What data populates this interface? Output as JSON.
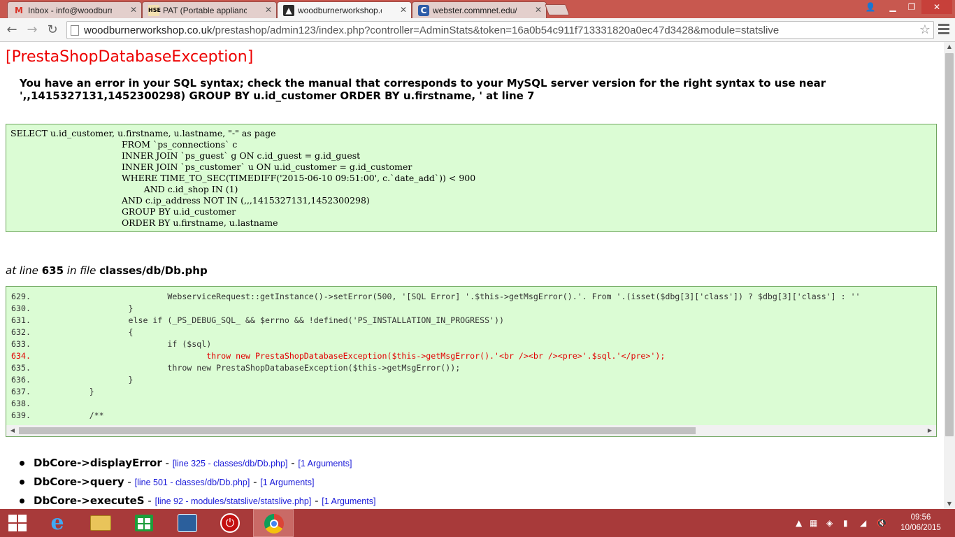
{
  "browser": {
    "tabs": [
      {
        "favicon": "gmail-icon",
        "label": "Inbox - info@woodburne",
        "active": false
      },
      {
        "favicon": "hse-icon",
        "label": "PAT (Portable appliance te",
        "active": false
      },
      {
        "favicon": "prestashop-icon",
        "label": "woodburnerworkshop.co.u",
        "active": true
      },
      {
        "favicon": "commnet-icon",
        "label": "webster.commnet.edu/dl/",
        "active": false
      }
    ],
    "url_host": "woodburnerworkshop.co.uk",
    "url_path": "/prestashop/admin123/index.php?controller=AdminStats&token=16a0b54c911f713331820a0ec47d3428&module=statslive"
  },
  "page": {
    "exception_title": "[PrestaShopDatabaseException]",
    "error_message": "You have an error in your SQL syntax; check the manual that corresponds to your MySQL server version for the right syntax to use near ',,1415327131,1452300298) GROUP BY u.id_customer ORDER BY u.firstname, ' at line 7",
    "sql_query": "SELECT u.id_customer, u.firstname, u.lastname, \"-\" as page\n\t\t\t\t\tFROM `ps_connections` c\n\t\t\t\t\tINNER JOIN `ps_guest` g ON c.id_guest = g.id_guest\n\t\t\t\t\tINNER JOIN `ps_customer` u ON u.id_customer = g.id_customer\n\t\t\t\t\tWHERE TIME_TO_SEC(TIMEDIFF('2015-06-10 09:51:00', c.`date_add`)) < 900\n\t\t\t\t\t\tAND c.id_shop IN (1)\n\t\t\t\t\tAND c.ip_address NOT IN (,,,1415327131,1452300298)\n\t\t\t\t\tGROUP BY u.id_customer\n\t\t\t\t\tORDER BY u.firstname, u.lastname",
    "at_line_prefix": "at line",
    "line_number": "635",
    "in_file_text": "in file",
    "file_path": "classes/db/Db.php",
    "code_lines": [
      {
        "no": "629.",
        "code": "\t\t\tWebserviceRequest::getInstance()->setError(500, '[SQL Error] '.$this->getMsgError().'. From '.(isset($dbg[3]['class']) ? $dbg[3]['class'] : ''",
        "error": false
      },
      {
        "no": "630.",
        "code": "\t\t}",
        "error": false
      },
      {
        "no": "631.",
        "code": "\t\telse if (_PS_DEBUG_SQL_ && $errno && !defined('PS_INSTALLATION_IN_PROGRESS'))",
        "error": false
      },
      {
        "no": "632.",
        "code": "\t\t{",
        "error": false
      },
      {
        "no": "633.",
        "code": "\t\t\tif ($sql)",
        "error": false
      },
      {
        "no": "634.",
        "code": "\t\t\t\tthrow new PrestaShopDatabaseException($this->getMsgError().'<br /><br /><pre>'.$sql.'</pre>');",
        "error": true
      },
      {
        "no": "635.",
        "code": "\t\t\tthrow new PrestaShopDatabaseException($this->getMsgError());",
        "error": false
      },
      {
        "no": "636.",
        "code": "\t\t}",
        "error": false
      },
      {
        "no": "637.",
        "code": "\t}",
        "error": false
      },
      {
        "no": "638.",
        "code": "",
        "error": false
      },
      {
        "no": "639.",
        "code": "\t/**",
        "error": false
      }
    ],
    "stack_trace": [
      {
        "function": "DbCore->displayError",
        "location": "[line 325 - classes/db/Db.php]",
        "args": "[1 Arguments]"
      },
      {
        "function": "DbCore->query",
        "location": "[line 501 - classes/db/Db.php]",
        "args": "[1 Arguments]"
      },
      {
        "function": "DbCore->executeS",
        "location": "[line 92 - modules/statslive/statslive.php]",
        "args": "[1 Arguments]"
      }
    ],
    "trace_dash": "-"
  },
  "taskbar": {
    "clock_time": "09:56",
    "clock_date": "10/06/2015"
  },
  "colors": {
    "exception_title": "#ed0000",
    "code_background": "#dbfcd4",
    "error_line": "#e20000",
    "taskbar": "#a83a3a",
    "tabbar": "#c8584f"
  }
}
